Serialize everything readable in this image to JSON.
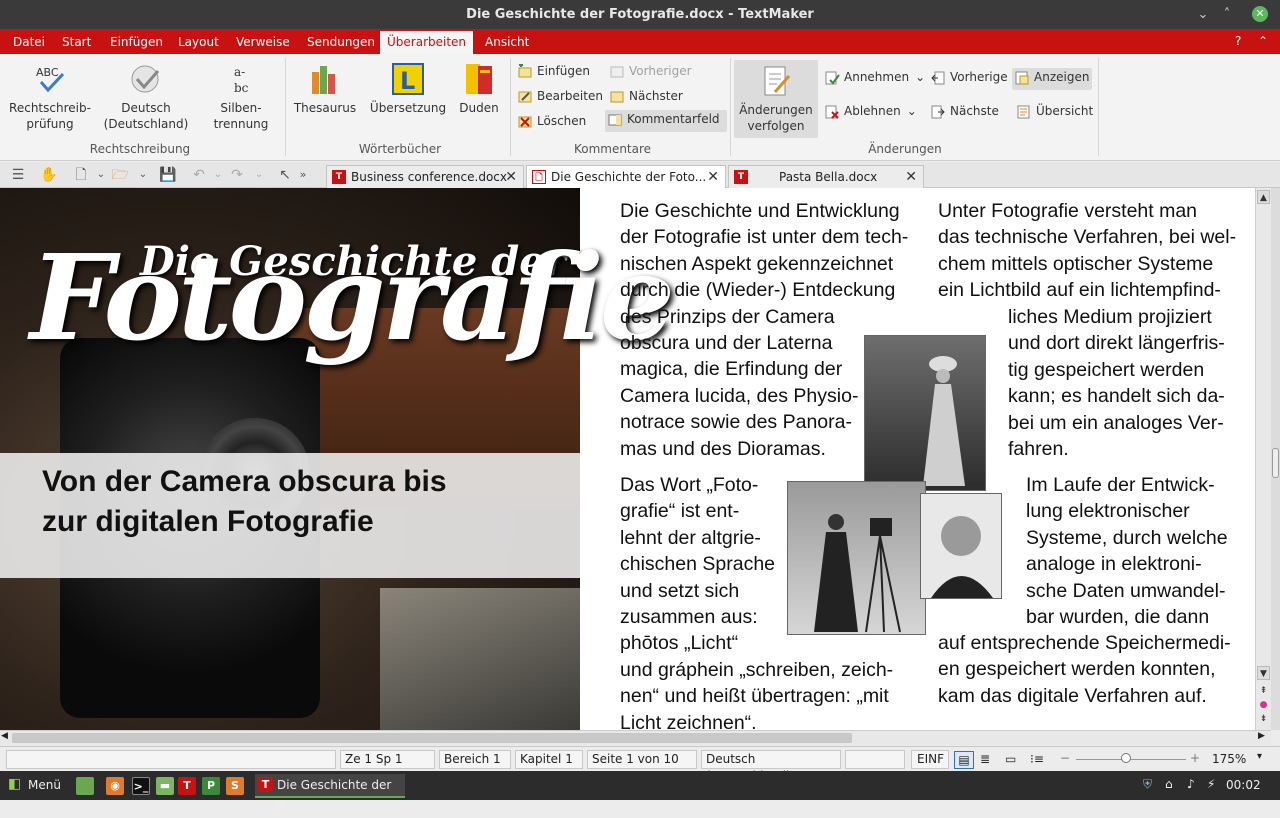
{
  "window": {
    "title": "Die Geschichte der Fotografie.docx - TextMaker"
  },
  "menu": [
    "Datei",
    "Start",
    "Einfügen",
    "Layout",
    "Verweise",
    "Sendungen",
    "Überarbeiten",
    "Ansicht"
  ],
  "menu_active": "Überarbeiten",
  "ribbon": {
    "rechtschreibung": {
      "label": "Rechtschreibung",
      "spell": "Rechtschreib-\nprüfung",
      "lang": "Deutsch\n(Deutschland)",
      "hyph": "Silben-\ntrennung"
    },
    "woerterbuecher": {
      "label": "Wörterbücher",
      "thesaurus": "Thesaurus",
      "translate": "Übersetzung",
      "duden": "Duden"
    },
    "kommentare": {
      "label": "Kommentare",
      "insert": "Einfügen",
      "edit": "Bearbeiten",
      "delete": "Löschen",
      "prev": "Vorheriger",
      "next": "Nächster",
      "field": "Kommentarfeld"
    },
    "aenderungen": {
      "label": "Änderungen",
      "track": "Änderungen\nverfolgen",
      "accept": "Annehmen",
      "reject": "Ablehnen",
      "prev": "Vorherige",
      "next": "Nächste",
      "show": "Anzeigen",
      "overview": "Übersicht"
    }
  },
  "tabs": [
    {
      "label": "Business conference.docx"
    },
    {
      "label": "Die Geschichte der Foto..."
    },
    {
      "label": "Pasta Bella.docx"
    }
  ],
  "hero": {
    "title_small": "Die Geschichte der",
    "title_big": "Fotografie",
    "subtitle1": "Von der Camera obscura bis",
    "subtitle2": "zur digitalen Fotografie"
  },
  "col1": [
    "Die Geschichte und Entwicklung",
    "der Fotografie ist unter dem tech-",
    "nischen Aspekt gekennzeichnet",
    "durch die (Wieder-) Entdeckung",
    "des Prinzips der Camera",
    "obscura und der Laterna",
    "magica, die Erfindung der",
    "Camera lucida, des Physio-",
    "notrace sowie des Panora-",
    "mas und des Dioramas."
  ],
  "col1b": [
    "Das Wort „Foto-",
    "grafie“ ist ent-",
    "lehnt der altgrie-",
    "chischen Sprache",
    "und setzt sich",
    "zusammen aus:",
    "phōtos  „Licht“",
    "und gráphein „schreiben, zeich-",
    "nen“ und heißt übertragen:  „mit",
    "Licht zeichnen“."
  ],
  "col2": [
    "Unter Fotografie versteht man",
    "das technische Verfahren, bei wel-",
    "chem mittels optischer Systeme",
    "ein Lichtbild auf ein lichtempfind-"
  ],
  "col2r": [
    "liches Medium projiziert",
    "und dort direkt längerfris-",
    "tig gespeichert werden",
    "kann; es handelt sich da-",
    "bei um ein analoges Ver-",
    "fahren."
  ],
  "col2b": [
    "Im Laufe der Entwick-",
    "lung elektronischer",
    "Systeme, durch welche",
    "analoge in elektroni-",
    "sche Daten umwandel-",
    "bar wurden, die dann"
  ],
  "col2c": [
    "auf entsprechende Speichermedi-",
    "en gespeichert werden konnten,",
    "kam das digitale Verfahren auf."
  ],
  "status": {
    "pos": "Ze 1 Sp 1",
    "area": "Bereich 1",
    "chapter": "Kapitel 1",
    "page": "Seite 1 von 10",
    "lang": "Deutsch (Deutschland)",
    "mode": "EINF",
    "zoom": "175%",
    "zoom_level": 0.45
  },
  "taskbar": {
    "menu": "Menü",
    "task": "Die Geschichte der F...",
    "clock": "00:02"
  },
  "colors": {
    "accent": "#c81212",
    "titlebar": "#3a3a3a"
  }
}
